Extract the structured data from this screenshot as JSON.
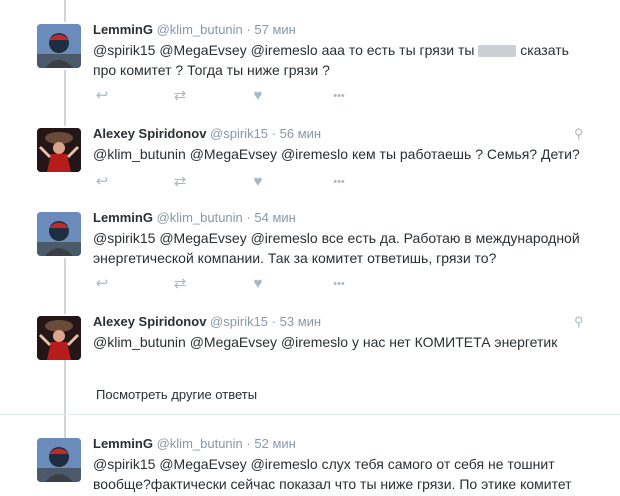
{
  "tweets": [
    {
      "name": "LemminG",
      "handle": "@klim_butunin",
      "dot": "·",
      "time": "57 мин",
      "text_pre": "@spirik15 @MegaEvsey @iremeslo ааа то есть ты грязи ты",
      "text_post": "сказать про комитет ? Тогда ты ниже грязи ?"
    },
    {
      "name": "Alexey Spiridonov",
      "handle": "@spirik15",
      "dot": "·",
      "time": "56 мин",
      "text": "@klim_butunin @MegaEvsey @iremeslo кем ты работаешь ? Семья? Дети?"
    },
    {
      "name": "LemminG",
      "handle": "@klim_butunin",
      "dot": "·",
      "time": "54 мин",
      "text": "@spirik15 @MegaEvsey @iremeslo все есть да. Работаю в международной энергетической  компании. Так за комитет ответишь, грязи то?"
    },
    {
      "name": "Alexey Spiridonov",
      "handle": "@spirik15",
      "dot": "·",
      "time": "53 мин",
      "text": "@klim_butunin @MegaEvsey @iremeslo у нас нет КОМИТЕТА энергетик"
    },
    {
      "name": "LemminG",
      "handle": "@klim_butunin",
      "dot": "·",
      "time": "52 мин",
      "text": "@spirik15 @MegaEvsey @iremeslo слух тебя самого от себя не тошнит вообще?фактически сейчас показал что ты ниже грязи. По этике комитет вообще"
    }
  ],
  "more_replies": "Посмотреть другие ответы",
  "icons": {
    "reply": "↩",
    "retweet": "⇄",
    "like": "♥",
    "more": "•••",
    "location": "⚲"
  },
  "colors": {
    "text": "#292f33",
    "muted": "#8899a6",
    "icon": "#aab8c2",
    "line": "#ccd6dd"
  }
}
